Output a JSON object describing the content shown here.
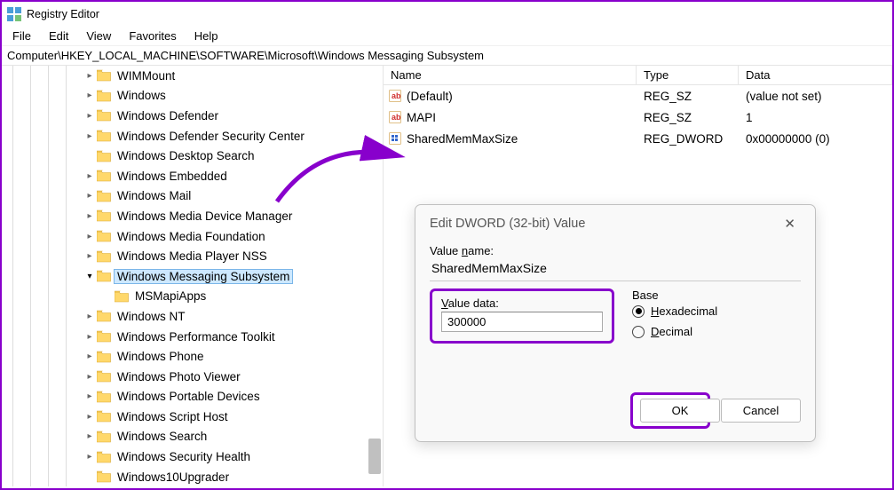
{
  "window": {
    "title": "Registry Editor"
  },
  "menu": [
    "File",
    "Edit",
    "View",
    "Favorites",
    "Help"
  ],
  "address": "Computer\\HKEY_LOCAL_MACHINE\\SOFTWARE\\Microsoft\\Windows Messaging Subsystem",
  "tree": [
    {
      "indent": 92,
      "label": "WIMMount",
      "chev": ">"
    },
    {
      "indent": 92,
      "label": "Windows",
      "chev": ">"
    },
    {
      "indent": 92,
      "label": "Windows Defender",
      "chev": ">"
    },
    {
      "indent": 92,
      "label": "Windows Defender Security Center",
      "chev": ">"
    },
    {
      "indent": 92,
      "label": "Windows Desktop Search",
      "chev": ""
    },
    {
      "indent": 92,
      "label": "Windows Embedded",
      "chev": ">"
    },
    {
      "indent": 92,
      "label": "Windows Mail",
      "chev": ">"
    },
    {
      "indent": 92,
      "label": "Windows Media Device Manager",
      "chev": ">"
    },
    {
      "indent": 92,
      "label": "Windows Media Foundation",
      "chev": ">"
    },
    {
      "indent": 92,
      "label": "Windows Media Player NSS",
      "chev": ">"
    },
    {
      "indent": 92,
      "label": "Windows Messaging Subsystem",
      "chev": "v",
      "selected": true
    },
    {
      "indent": 112,
      "label": "MSMapiApps",
      "chev": ""
    },
    {
      "indent": 92,
      "label": "Windows NT",
      "chev": ">"
    },
    {
      "indent": 92,
      "label": "Windows Performance Toolkit",
      "chev": ">"
    },
    {
      "indent": 92,
      "label": "Windows Phone",
      "chev": ">"
    },
    {
      "indent": 92,
      "label": "Windows Photo Viewer",
      "chev": ">"
    },
    {
      "indent": 92,
      "label": "Windows Portable Devices",
      "chev": ">"
    },
    {
      "indent": 92,
      "label": "Windows Script Host",
      "chev": ">"
    },
    {
      "indent": 92,
      "label": "Windows Search",
      "chev": ">"
    },
    {
      "indent": 92,
      "label": "Windows Security Health",
      "chev": ">"
    },
    {
      "indent": 92,
      "label": "Windows10Upgrader",
      "chev": ""
    }
  ],
  "list_header": {
    "name": "Name",
    "type": "Type",
    "data": "Data"
  },
  "list": [
    {
      "icon": "str",
      "name": "(Default)",
      "type": "REG_SZ",
      "data": "(value not set)"
    },
    {
      "icon": "str",
      "name": "MAPI",
      "type": "REG_SZ",
      "data": "1"
    },
    {
      "icon": "bin",
      "name": "SharedMemMaxSize",
      "type": "REG_DWORD",
      "data": "0x00000000 (0)"
    }
  ],
  "dialog": {
    "title": "Edit DWORD (32-bit) Value",
    "value_name_label": "Value name:",
    "value_name": "SharedMemMaxSize",
    "value_data_label": "Value data:",
    "value_data": "300000",
    "base_label": "Base",
    "hex_label": "Hexadecimal",
    "dec_label": "Decimal",
    "ok": "OK",
    "cancel": "Cancel"
  }
}
